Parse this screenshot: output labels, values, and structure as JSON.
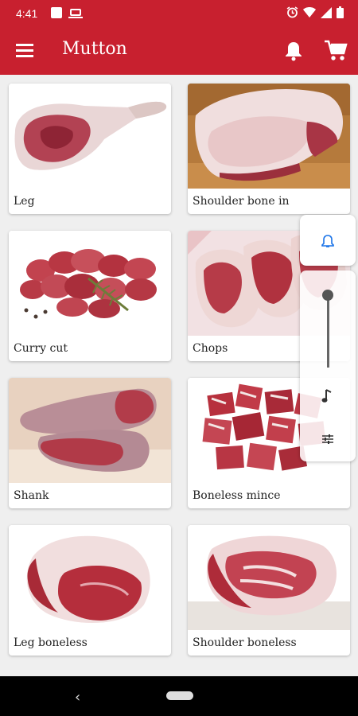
{
  "status_bar": {
    "time": "4:41"
  },
  "app_bar": {
    "title": "Mutton",
    "menu_icon": "hamburger-menu-icon",
    "notification_icon": "bell-icon",
    "cart_icon": "cart-icon"
  },
  "products": [
    {
      "name": "Leg"
    },
    {
      "name": "Shoulder bone in"
    },
    {
      "name": "Curry cut"
    },
    {
      "name": "Chops"
    },
    {
      "name": "Shank"
    },
    {
      "name": "Boneless mince"
    },
    {
      "name": "Leg boneless"
    },
    {
      "name": "Shoulder boneless"
    }
  ],
  "volume_panel": {
    "ring_icon": "bell-icon",
    "media_icon": "music-note-icon",
    "settings_icon": "equalizer-icon",
    "level": 0.9
  },
  "colors": {
    "primary": "#c8202f",
    "background": "#efefef",
    "accent": "#1a73e8"
  }
}
